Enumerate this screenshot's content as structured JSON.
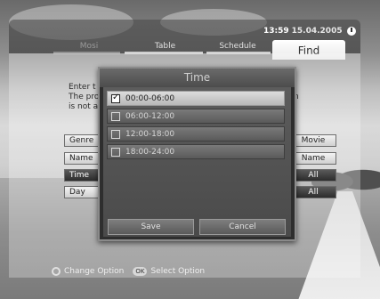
{
  "header": {
    "time": "13:59",
    "date": "15.04.2005",
    "tabs": [
      {
        "label": "Mosi",
        "state": "dim"
      },
      {
        "label": "Table",
        "state": "normal"
      },
      {
        "label": "Schedule",
        "state": "normal"
      },
      {
        "label": "Find",
        "state": "active"
      }
    ]
  },
  "content": {
    "text_left": "Enter t\nThe pro\nis not a",
    "text_right": "n",
    "options": [
      {
        "label": "Genre",
        "value": "Movie",
        "active": false
      },
      {
        "label": "Name",
        "value": "Name",
        "active": false
      },
      {
        "label": "Time",
        "value": "All",
        "active": true
      },
      {
        "label": "Day",
        "value": "All",
        "active": false
      }
    ]
  },
  "modal": {
    "title": "Time",
    "options": [
      {
        "label": "00:00-06:00",
        "checked": true,
        "highlighted": true
      },
      {
        "label": "06:00-12:00",
        "checked": false,
        "highlighted": false
      },
      {
        "label": "12:00-18:00",
        "checked": false,
        "highlighted": false
      },
      {
        "label": "18:00-24:00",
        "checked": false,
        "highlighted": false
      }
    ],
    "save_label": "Save",
    "cancel_label": "Cancel"
  },
  "hints": {
    "change_option": "Change Option",
    "ok_key": "OK",
    "select_option": "Select Option"
  }
}
